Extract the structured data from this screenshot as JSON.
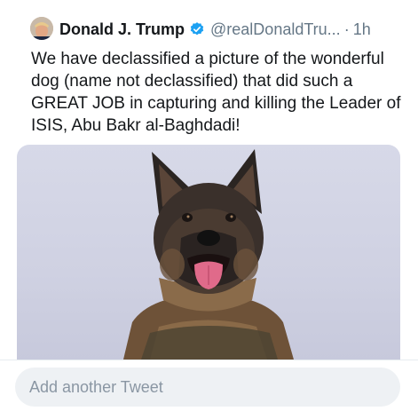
{
  "tweet": {
    "author_name": "Donald J. Trump",
    "handle": "@realDonaldTru...",
    "separator": "·",
    "time": "1h",
    "verified_icon": "verified-badge-icon",
    "text": "We have declassified a picture of the wonderful dog (name not declassified) that did such a GREAT JOB in capturing and killing the Leader of ISIS, Abu Bakr al-Baghdadi!",
    "colors": {
      "verified": "#1da1f2",
      "secondary_text": "#657786"
    }
  },
  "compose": {
    "placeholder": "Add another Tweet"
  }
}
